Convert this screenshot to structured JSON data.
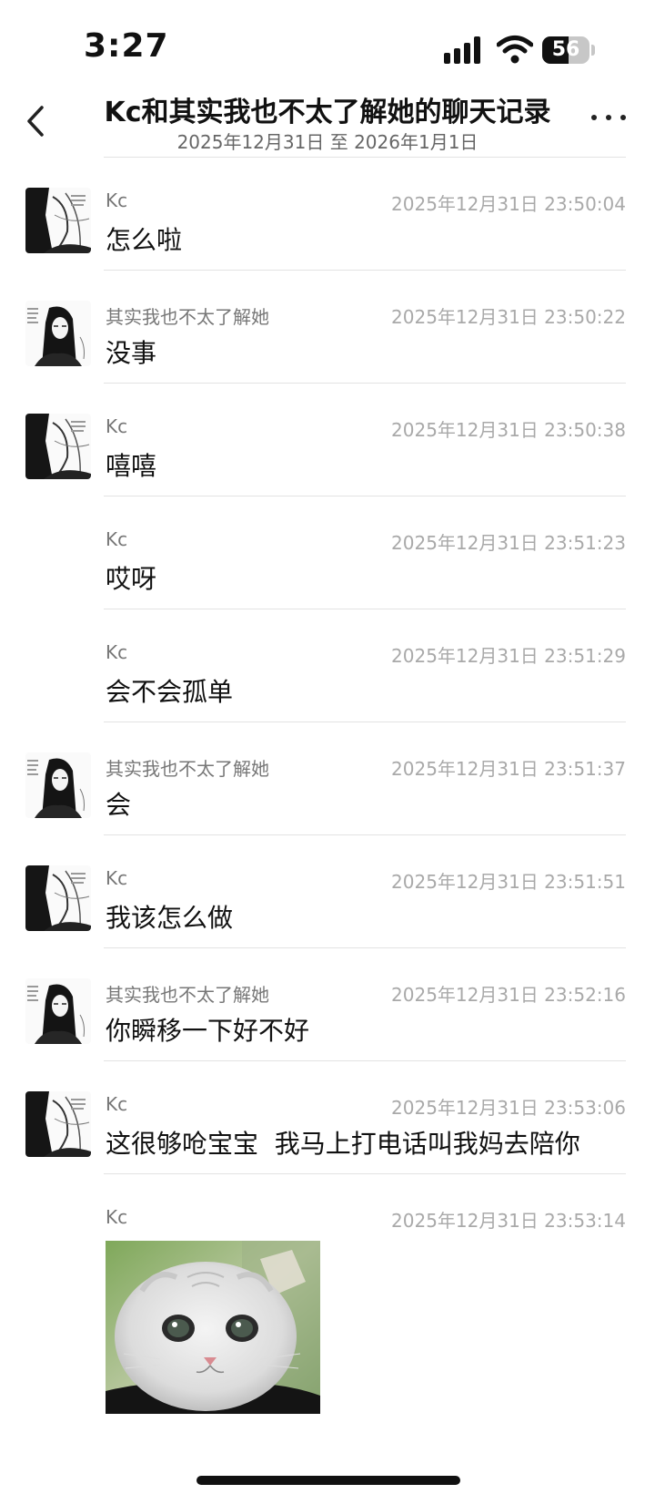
{
  "status_bar": {
    "time": "3:27",
    "battery": "56",
    "battery_level_percent": 56,
    "icons": [
      "signal-icon",
      "wifi-icon",
      "battery-icon"
    ]
  },
  "nav": {
    "title": "Kc和其实我也不太了解她的聊天记录",
    "subtitle": "2025年12月31日 至 2026年1月1日",
    "icons": [
      "back-chevron-icon",
      "more-dots-icon"
    ]
  },
  "messages": [
    {
      "sender": "Kc",
      "time": "2025年12月31日 23:50:04",
      "text": "怎么啦"
    },
    {
      "sender": "其实我也不太了解她",
      "time": "2025年12月31日 23:50:22",
      "text": "没事"
    },
    {
      "sender": "Kc",
      "time": "2025年12月31日 23:50:38",
      "text": "嘻嘻"
    },
    {
      "sender": "Kc",
      "time": "2025年12月31日 23:51:23",
      "text": "哎呀"
    },
    {
      "sender": "Kc",
      "time": "2025年12月31日 23:51:29",
      "text": "会不会孤单"
    },
    {
      "sender": "其实我也不太了解她",
      "time": "2025年12月31日 23:51:37",
      "text": "会"
    },
    {
      "sender": "Kc",
      "time": "2025年12月31日 23:51:51",
      "text": "我该怎么做"
    },
    {
      "sender": "其实我也不太了解她",
      "time": "2025年12月31日 23:52:16",
      "text": "你瞬移一下好不好"
    },
    {
      "sender": "Kc",
      "time": "2025年12月31日 23:53:06",
      "text": "这很够呛宝宝  我马上打电话叫我妈去陪你"
    },
    {
      "sender": "Kc",
      "time": "2025年12月31日 23:53:14",
      "image": "cat-photo"
    }
  ]
}
